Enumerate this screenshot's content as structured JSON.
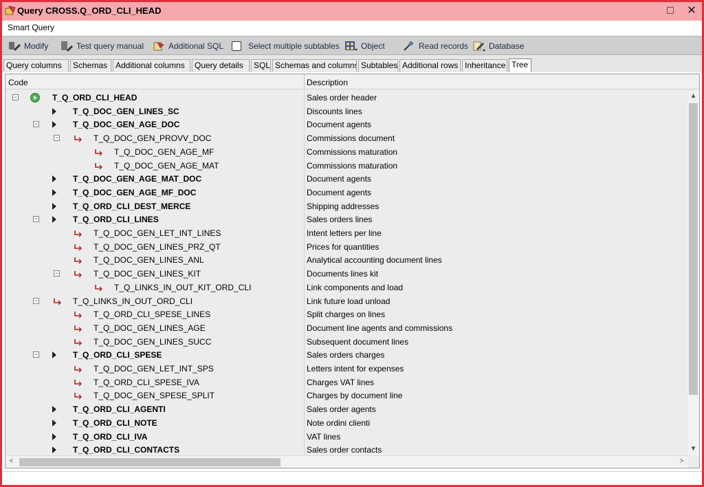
{
  "window": {
    "title": "Query CROSS.Q_ORD_CLI_HEAD",
    "minimize_glyph": "□",
    "close_glyph": "✕",
    "border_color": "#e0303a",
    "title_bg": "#f5a9ad"
  },
  "menu": {
    "label": "Smart Query"
  },
  "toolbar": {
    "modify": "Modify",
    "test_query": "Test query manual",
    "additional_sql": "Additional SQL",
    "select_multiple": "Select multiple subtables",
    "object": "Object",
    "read_records": "Read records",
    "database": "Database"
  },
  "tabs": [
    "Query columns",
    "Schemas",
    "Additional columns",
    "Query details",
    "SQL",
    "Schemas and columns",
    "Subtables",
    "Additional rows",
    "Inheritance",
    "Tree"
  ],
  "active_tab": "Tree",
  "tree": {
    "headers": {
      "code": "Code",
      "description": "Description"
    },
    "rows": [
      {
        "code": "T_Q_ORD_CLI_HEAD",
        "desc": "Sales order header",
        "level": 0,
        "bold": true,
        "icon": "root-icon",
        "expander": "minus"
      },
      {
        "code": "T_Q_DOC_GEN_LINES_SC",
        "desc": "Discounts lines",
        "level": 1,
        "bold": true,
        "icon": "arrow-icon",
        "expander": "none"
      },
      {
        "code": "T_Q_DOC_GEN_AGE_DOC",
        "desc": "Document agents",
        "level": 1,
        "bold": true,
        "icon": "arrow-icon",
        "expander": "minus"
      },
      {
        "code": "T_Q_DOC_GEN_PROVV_DOC",
        "desc": "Commissions document",
        "level": 2,
        "bold": false,
        "icon": "link-icon",
        "expander": "minus"
      },
      {
        "code": "T_Q_DOC_GEN_AGE_MF",
        "desc": "Commissions maturation",
        "level": 3,
        "bold": false,
        "icon": "link-icon",
        "expander": "none"
      },
      {
        "code": "T_Q_DOC_GEN_AGE_MAT",
        "desc": "Commissions maturation",
        "level": 3,
        "bold": false,
        "icon": "link-icon",
        "expander": "none"
      },
      {
        "code": "T_Q_DOC_GEN_AGE_MAT_DOC",
        "desc": "Document agents",
        "level": 1,
        "bold": true,
        "icon": "arrow-icon",
        "expander": "none"
      },
      {
        "code": "T_Q_DOC_GEN_AGE_MF_DOC",
        "desc": "Document agents",
        "level": 1,
        "bold": true,
        "icon": "arrow-icon",
        "expander": "none"
      },
      {
        "code": "T_Q_ORD_CLI_DEST_MERCE",
        "desc": "Shipping addresses",
        "level": 1,
        "bold": true,
        "icon": "arrow-icon",
        "expander": "none"
      },
      {
        "code": "T_Q_ORD_CLI_LINES",
        "desc": "Sales orders lines",
        "level": 1,
        "bold": true,
        "icon": "arrow-icon",
        "expander": "minus"
      },
      {
        "code": "T_Q_DOC_GEN_LET_INT_LINES",
        "desc": "Intent letters per line",
        "level": 2,
        "bold": false,
        "icon": "link-icon",
        "expander": "none"
      },
      {
        "code": "T_Q_DOC_GEN_LINES_PRZ_QT",
        "desc": "Prices for quantities",
        "level": 2,
        "bold": false,
        "icon": "link-icon",
        "expander": "none"
      },
      {
        "code": "T_Q_DOC_GEN_LINES_ANL",
        "desc": "Analytical accounting document lines",
        "level": 2,
        "bold": false,
        "icon": "link-icon",
        "expander": "none"
      },
      {
        "code": "T_Q_DOC_GEN_LINES_KIT",
        "desc": "Documents lines kit",
        "level": 2,
        "bold": false,
        "icon": "link-icon",
        "expander": "minus"
      },
      {
        "code": "T_Q_LINKS_IN_OUT_KIT_ORD_CLI",
        "desc": "Link components and load",
        "level": 3,
        "bold": false,
        "icon": "link-icon",
        "expander": "none"
      },
      {
        "code": "T_Q_LINKS_IN_OUT_ORD_CLI",
        "desc": "Link future load unload",
        "level": 1,
        "bold": false,
        "icon": "link-icon",
        "expander": "minus"
      },
      {
        "code": "T_Q_ORD_CLI_SPESE_LINES",
        "desc": "Split charges on lines",
        "level": 2,
        "bold": false,
        "icon": "link-icon",
        "expander": "none"
      },
      {
        "code": "T_Q_DOC_GEN_LINES_AGE",
        "desc": "Document line agents and commissions",
        "level": 2,
        "bold": false,
        "icon": "link-icon",
        "expander": "none"
      },
      {
        "code": "T_Q_DOC_GEN_LINES_SUCC",
        "desc": "Subsequent document lines",
        "level": 2,
        "bold": false,
        "icon": "link-icon",
        "expander": "none"
      },
      {
        "code": "T_Q_ORD_CLI_SPESE",
        "desc": "Sales orders charges",
        "level": 1,
        "bold": true,
        "icon": "arrow-icon",
        "expander": "minus"
      },
      {
        "code": "T_Q_DOC_GEN_LET_INT_SPS",
        "desc": "Letters intent for expenses",
        "level": 2,
        "bold": false,
        "icon": "link-icon",
        "expander": "none"
      },
      {
        "code": "T_Q_ORD_CLI_SPESE_IVA",
        "desc": "Charges VAT lines",
        "level": 2,
        "bold": false,
        "icon": "link-icon",
        "expander": "none"
      },
      {
        "code": "T_Q_DOC_GEN_SPESE_SPLIT",
        "desc": "Charges by document line",
        "level": 2,
        "bold": false,
        "icon": "link-icon",
        "expander": "none"
      },
      {
        "code": "T_Q_ORD_CLI_AGENTI",
        "desc": "Sales order agents",
        "level": 1,
        "bold": true,
        "icon": "arrow-icon",
        "expander": "none"
      },
      {
        "code": "T_Q_ORD_CLI_NOTE",
        "desc": "Note ordini clienti",
        "level": 1,
        "bold": true,
        "icon": "arrow-icon",
        "expander": "none"
      },
      {
        "code": "T_Q_ORD_CLI_IVA",
        "desc": "VAT lines",
        "level": 1,
        "bold": true,
        "icon": "arrow-icon",
        "expander": "none"
      },
      {
        "code": "T_Q_ORD_CLI_CONTACTS",
        "desc": "Sales order contacts",
        "level": 1,
        "bold": true,
        "icon": "arrow-icon",
        "expander": "none"
      }
    ]
  },
  "scroll": {
    "up": "▲",
    "down": "▼",
    "left": "<",
    "right": ">"
  }
}
